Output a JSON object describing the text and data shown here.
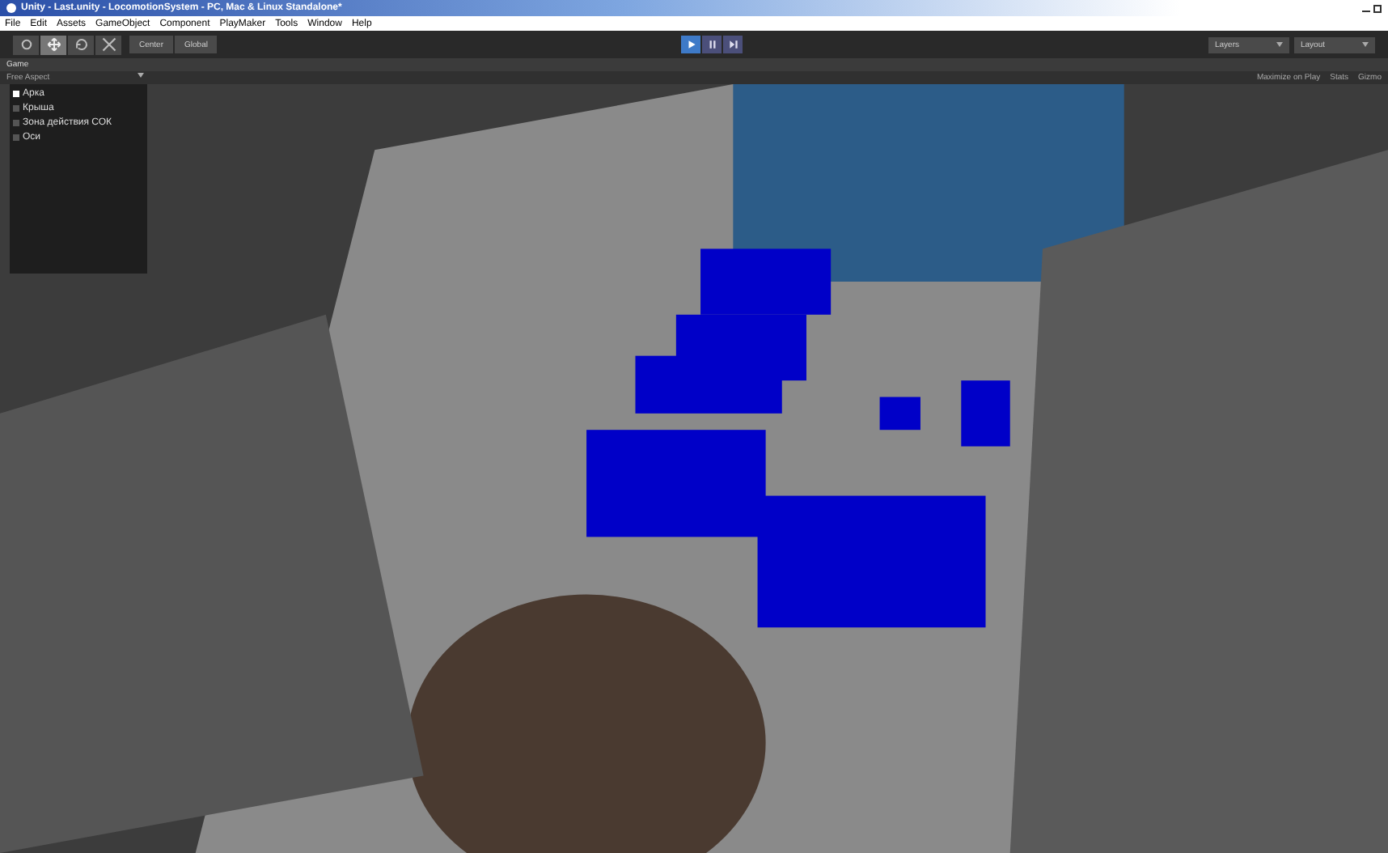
{
  "window": {
    "title": "Unity - Last.unity - LocomotionSystem - PC, Mac & Linux Standalone*"
  },
  "menu": [
    "File",
    "Edit",
    "Assets",
    "GameObject",
    "Component",
    "PlayMaker",
    "Tools",
    "Window",
    "Help"
  ],
  "toolbar": {
    "tools": [
      {
        "kind": "hand",
        "selected": false
      },
      {
        "kind": "move",
        "selected": true
      },
      {
        "kind": "rotate",
        "selected": false
      },
      {
        "kind": "scale",
        "selected": false
      }
    ],
    "pivot": [
      "Center",
      "Global"
    ],
    "playback": [
      {
        "kind": "play",
        "selected": true
      },
      {
        "kind": "pause",
        "selected": false
      },
      {
        "kind": "step",
        "selected": false
      }
    ],
    "layers": "Layers",
    "layout": "Layout"
  },
  "game_tab": {
    "label": "Game"
  },
  "game_toolbar": {
    "aspect": "Free Aspect",
    "options": [
      "Maximize on Play",
      "Stats",
      "Gizmo"
    ]
  },
  "toggles": [
    {
      "label": "Арка",
      "checked": true
    },
    {
      "label": "Крыша",
      "checked": false
    },
    {
      "label": "Зона действия СОК",
      "checked": false
    },
    {
      "label": "Оси",
      "checked": false
    }
  ]
}
